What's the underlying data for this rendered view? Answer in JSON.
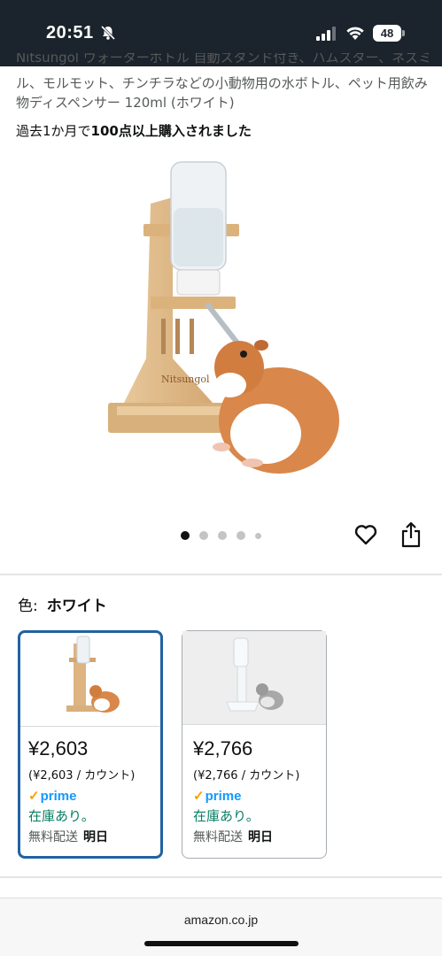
{
  "status_bar": {
    "time": "20:51",
    "battery": "48"
  },
  "product": {
    "title_partial": "Nitsungol ウォーターボトル 自動スタンド付き、ハムスター、ネズミ",
    "title": "ル、モルモット、チンチラなどの小動物用の水ボトル、ペット用飲み物ディスペンサー 120ml (ホワイト)",
    "purchased_prefix": "過去1か月で",
    "purchased_bold": "100点以上購入されました",
    "image_logo_text": "Nitsungol"
  },
  "carousel": {
    "total": 5,
    "active_index": 0
  },
  "color": {
    "label": "色:",
    "value": "ホワイト"
  },
  "variants": [
    {
      "price": "¥2,603",
      "unit_price": "(¥2,603 / カウント)",
      "prime": "prime",
      "stock": "在庫あり。",
      "shipping": "無料配送",
      "delivery": "明日"
    },
    {
      "price": "¥2,766",
      "unit_price": "(¥2,766 / カウント)",
      "prime": "prime",
      "stock": "在庫あり。",
      "shipping": "無料配送",
      "delivery": "明日"
    }
  ],
  "browser": {
    "url": "amazon.co.jp"
  },
  "icons": {
    "wishlist": "heart-icon",
    "share": "share-icon",
    "mute": "bell-slash-icon",
    "signal": "signal-icon",
    "wifi": "wifi-icon"
  },
  "colors": {
    "status_bar_bg": "#1b232c",
    "selected_border": "#2162a1",
    "in_stock": "#067d62",
    "prime_blue": "#1399ff",
    "prime_check": "#f7a000"
  }
}
